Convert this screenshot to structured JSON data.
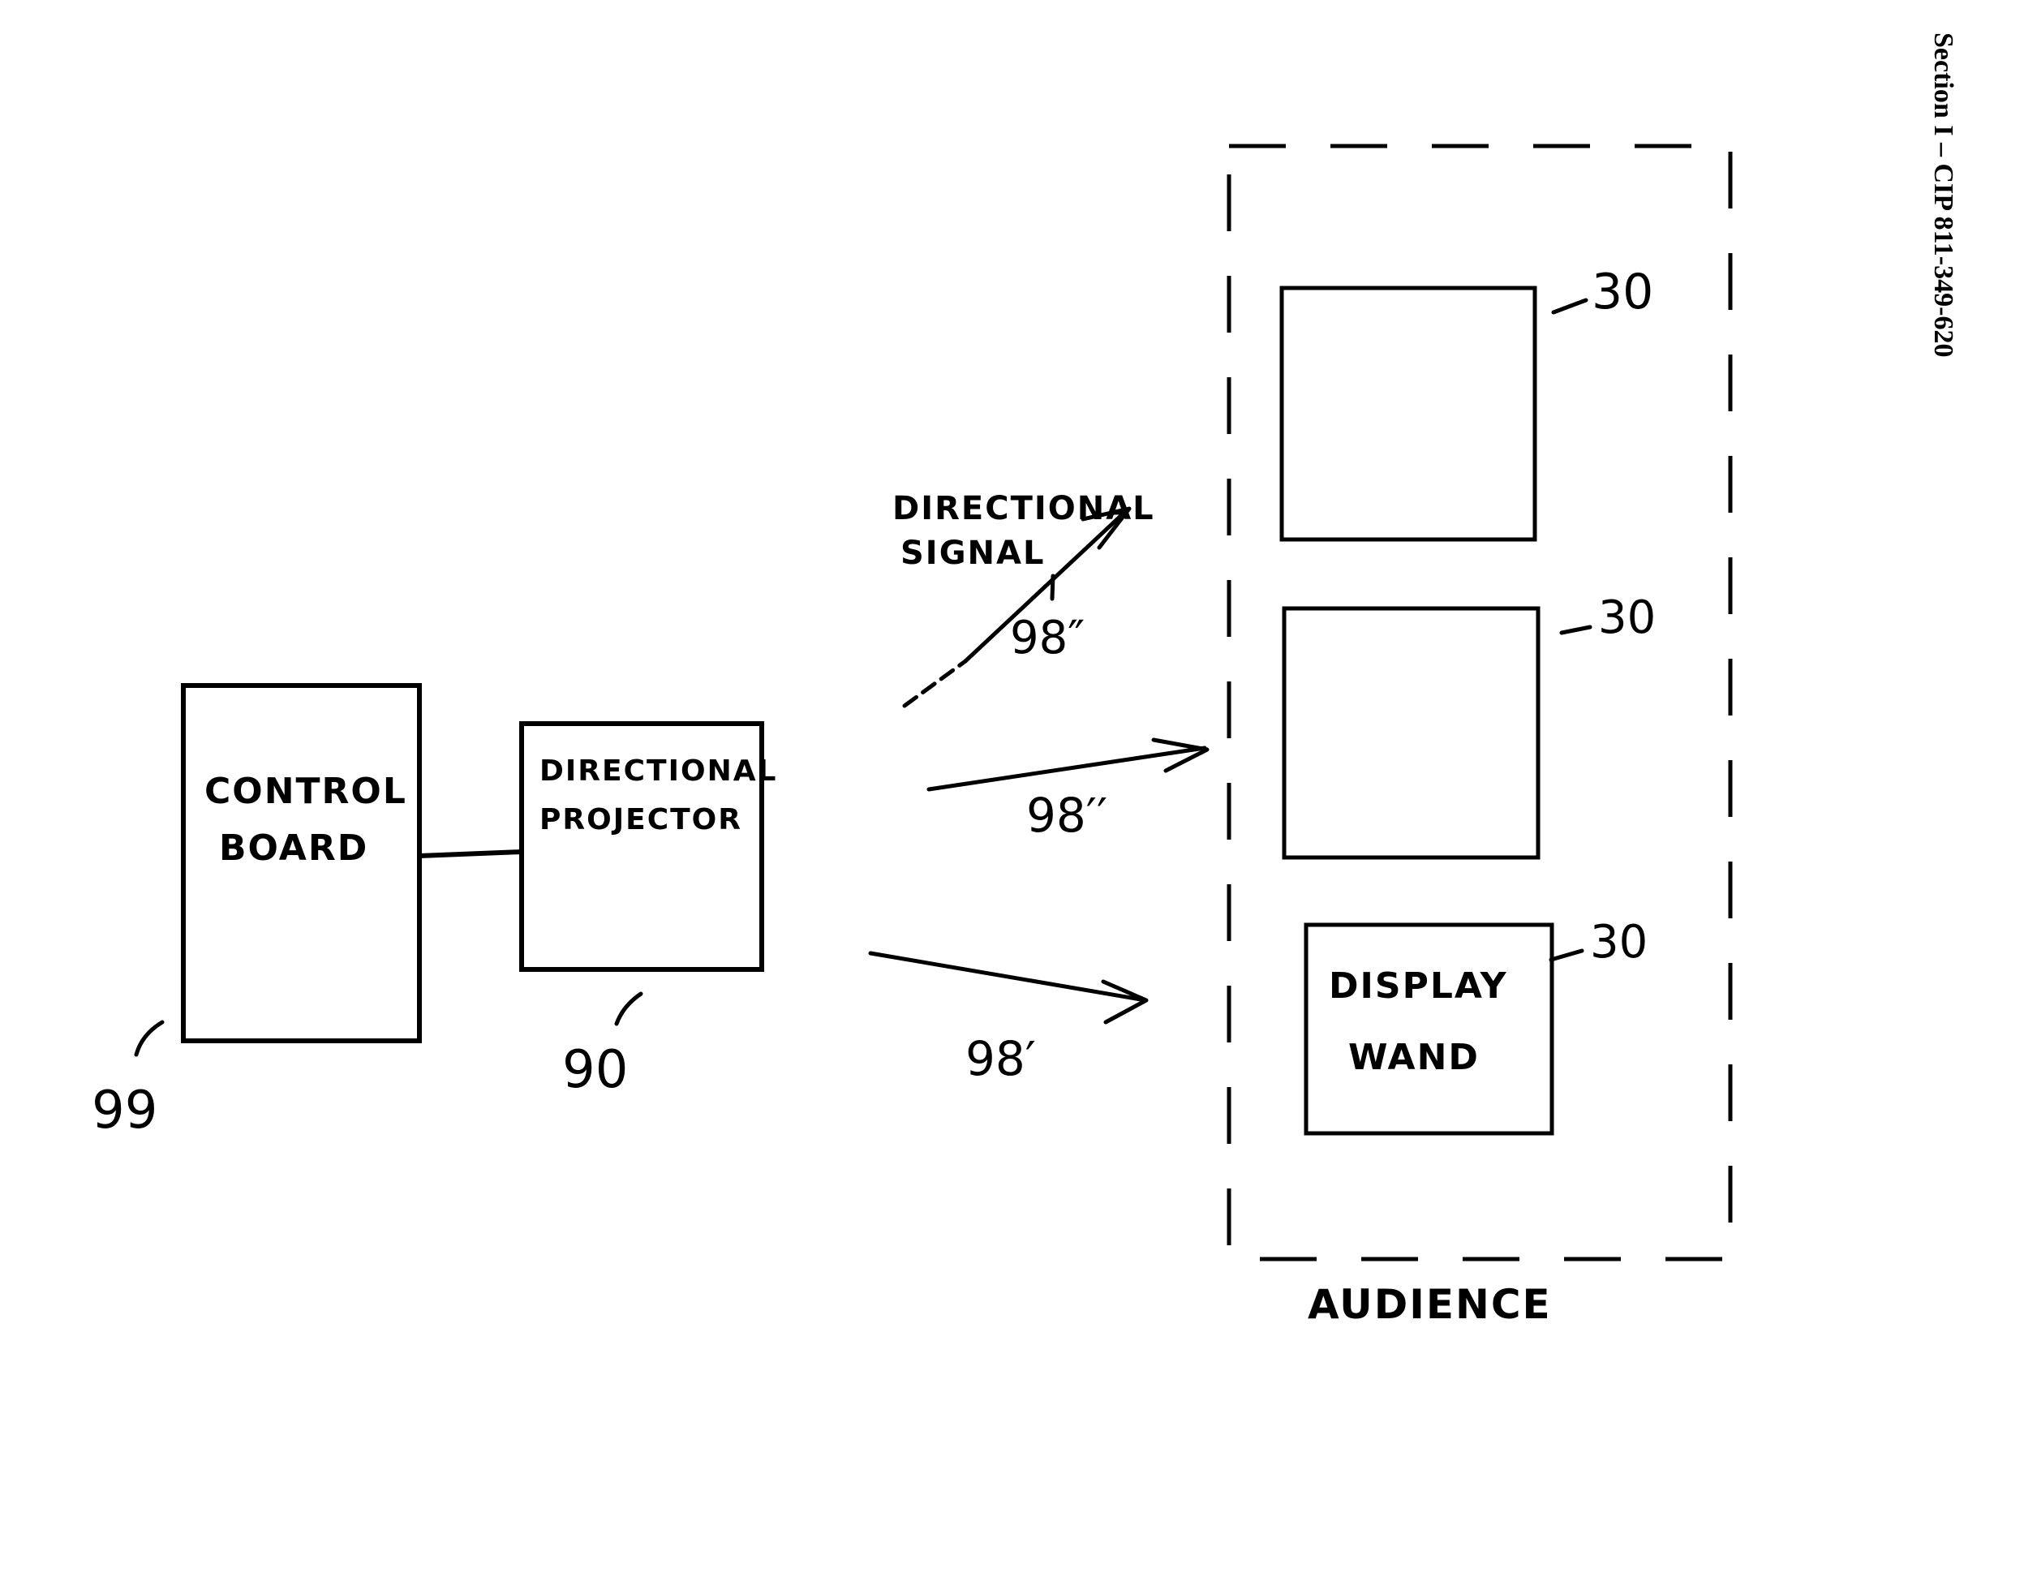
{
  "header": {
    "section_label": "Section I – CIP 811-349-620"
  },
  "blocks": {
    "control_board": {
      "line1": "CONTROL",
      "line2": "BOARD",
      "ref": "99"
    },
    "directional_projector": {
      "line1": "DIRECTIONAL",
      "line2": "PROJECTOR",
      "ref": "90"
    },
    "display_wands": [
      {
        "line1": "",
        "line2": "",
        "ref": "-30"
      },
      {
        "line1": "",
        "line2": "",
        "ref": "-30"
      },
      {
        "line1": "DISPLAY",
        "line2": "WAND",
        "ref": "-30"
      }
    ]
  },
  "signals": {
    "top": {
      "label_line1": "DIRECTIONAL",
      "label_line2": "SIGNAL",
      "ref": "98″"
    },
    "middle": {
      "ref": "98′′"
    },
    "bottom": {
      "ref": "98′"
    }
  },
  "audience": {
    "label": "AUDIENCE"
  }
}
